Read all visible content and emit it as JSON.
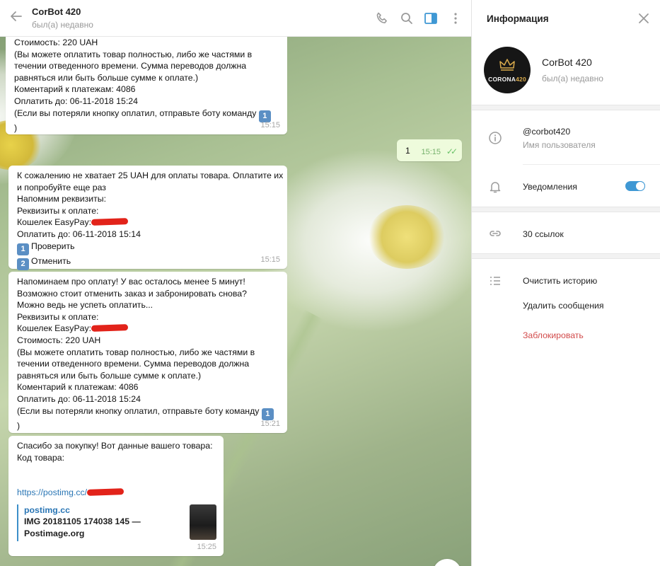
{
  "header": {
    "title": "CorBot 420",
    "status": "был(а) недавно"
  },
  "messages": {
    "m1": {
      "lines": [
        "Стоимость: 220 UAH",
        "(Вы можете оплатить товар полностью, либо же частями в",
        "течении отведенного времени. Сумма переводов должна",
        "равняться или быть больше сумме к оплате.)",
        "Коментарий к платежам: 4086",
        "Оплатить до: 06-11-2018 15:24",
        "(Если вы потеряли кнопку оплатил, отправьте боту команду",
        ")"
      ],
      "emoji": "1",
      "time": "15:15"
    },
    "m2": {
      "text": "1",
      "time": "15:15",
      "checks": "✓✓"
    },
    "m3": {
      "lines": [
        "К сожалению не хватает 25 UAH для оплаты товара. Оплатите их",
        "и попробуйте еще раз",
        "Напомним реквизиты:",
        "Реквизиты к оплате:",
        "Кошелек EasyPay:",
        "Оплатить до: 06-11-2018 15:14",
        "Проверить",
        "Отменить"
      ],
      "key1": "1",
      "key2": "2",
      "time": "15:15"
    },
    "m4": {
      "lines": [
        "Напоминаем про оплату! У вас осталось менее 5 минут!",
        "Возможно стоит отменить заказ и забронировать снова?",
        "Можно ведь не успеть оплатить...",
        "Реквизиты к оплате:",
        "Кошелек EasyPay:",
        "Стоимость: 220 UAH",
        "(Вы можете оплатить товар полностью, либо же частями в",
        "течении отведенного времени. Сумма переводов должна",
        "равняться или быть больше сумме к оплате.)",
        "Коментарий к платежам: 4086",
        "Оплатить до: 06-11-2018 15:24",
        "(Если вы потеряли кнопку оплатил, отправьте боту команду",
        ")"
      ],
      "emoji": "1",
      "time": "15:21"
    },
    "m5": {
      "lines": [
        "Спасибо за покупку! Вот данные вашего товара:",
        "Код товара:"
      ],
      "link": "https://postimg.cc/",
      "preview_site": "postimg.cc",
      "preview_title_1": "IMG 20181105 174038 145 —",
      "preview_title_2": "Postimage.org",
      "time": "15:25"
    }
  },
  "info": {
    "title": "Информация",
    "avatar_text_1": "CORONA",
    "avatar_text_2": "420",
    "name": "CorBot 420",
    "status": "был(а) недавно",
    "username": "@corbot420",
    "username_label": "Имя пользователя",
    "notifications_label": "Уведомления",
    "notifications_on": true,
    "links_label": "30 ссылок",
    "clear_history": "Очистить историю",
    "delete_messages": "Удалить сообщения",
    "block": "Заблокировать"
  },
  "colors": {
    "accent": "#3f98d4",
    "outgoing_bubble": "#eefbdc",
    "danger": "#d24b4b"
  }
}
